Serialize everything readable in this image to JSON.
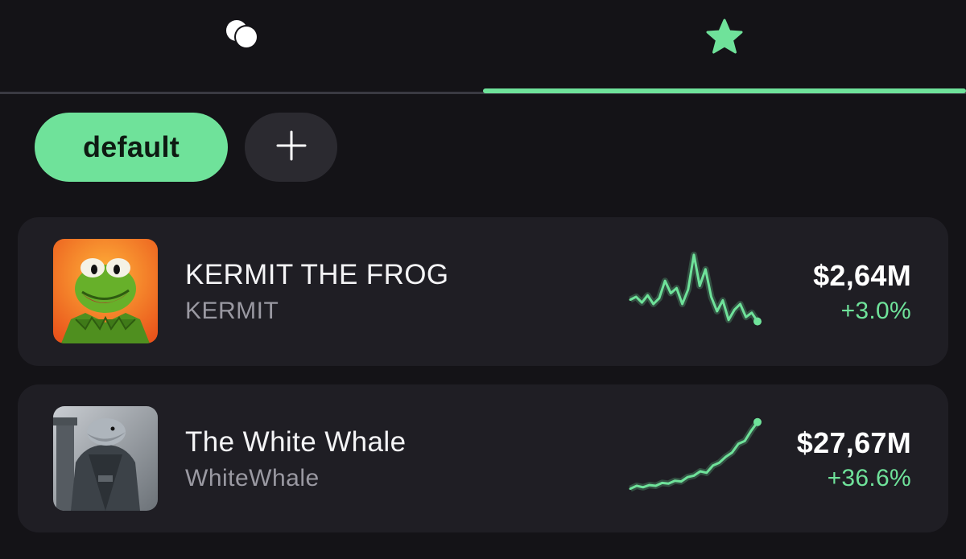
{
  "tabs": [
    {
      "icon": "coins-icon",
      "active": false
    },
    {
      "icon": "star-icon",
      "active": true
    }
  ],
  "accent_color": "#6fe29a",
  "filters": {
    "active_label": "default",
    "add_label": "+"
  },
  "tokens": [
    {
      "name": "KERMIT THE FROG",
      "ticker": "KERMIT",
      "price": "$2,64M",
      "change": "+3.0%",
      "avatar": "kermit-avatar",
      "trend": [
        0.36,
        0.4,
        0.32,
        0.42,
        0.3,
        0.38,
        0.62,
        0.45,
        0.52,
        0.3,
        0.5,
        0.98,
        0.55,
        0.78,
        0.4,
        0.2,
        0.35,
        0.08,
        0.22,
        0.3,
        0.12,
        0.18,
        0.06
      ]
    },
    {
      "name": "The White Whale",
      "ticker": "WhiteWhale",
      "price": "$27,67M",
      "change": "+36.6%",
      "avatar": "white-whale-avatar",
      "trend": [
        0.06,
        0.1,
        0.08,
        0.11,
        0.1,
        0.14,
        0.13,
        0.17,
        0.16,
        0.22,
        0.24,
        0.3,
        0.28,
        0.38,
        0.42,
        0.5,
        0.56,
        0.68,
        0.72,
        0.86,
        0.98
      ]
    }
  ]
}
